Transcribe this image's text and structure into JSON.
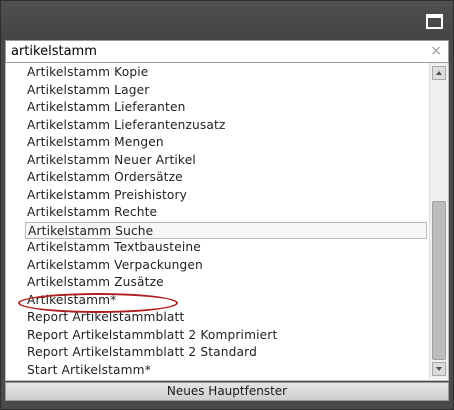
{
  "search": {
    "value": "artikelstamm"
  },
  "results": [
    "Artikelstamm Kopie",
    "Artikelstamm Lager",
    "Artikelstamm Lieferanten",
    "Artikelstamm Lieferantenzusatz",
    "Artikelstamm Mengen",
    "Artikelstamm Neuer Artikel",
    "Artikelstamm Ordersätze",
    "Artikelstamm Preishistory",
    "Artikelstamm Rechte",
    "Artikelstamm Suche",
    "Artikelstamm Textbausteine",
    "Artikelstamm Verpackungen",
    "Artikelstamm Zusätze",
    "Artikelstamm*",
    "Report Artikelstammblatt",
    "Report Artikelstammblatt 2 Komprimiert",
    "Report Artikelstammblatt 2 Standard",
    "Start Artikelstamm*"
  ],
  "footer": {
    "new_window_label": "Neues Hauptfenster"
  },
  "icons": {
    "maximize": "maximize-icon",
    "clear": "clear-icon",
    "scroll_up": "scroll-up-arrow-icon",
    "scroll_down": "scroll-down-arrow-icon"
  },
  "colors": {
    "titlebar": "#4a4a4a",
    "annotation": "#b01e1e"
  }
}
